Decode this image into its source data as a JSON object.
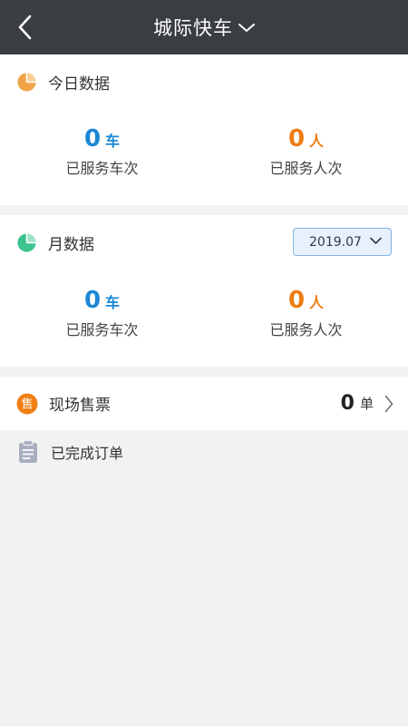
{
  "navbar": {
    "title": "城际快车",
    "back_icon": "back-chevron-icon",
    "dropdown_icon": "chevron-down-icon",
    "background": "#3a3d42"
  },
  "today": {
    "title": "今日数据",
    "icon": "pie-chart-icon",
    "icon_color": "#f0a44a",
    "stats": [
      {
        "value": "0",
        "unit": "车",
        "caption": "已服务车次",
        "color": "#1b87d6"
      },
      {
        "value": "0",
        "unit": "人",
        "caption": "已服务人次",
        "color": "#ed7d12"
      }
    ]
  },
  "month": {
    "title": "月数据",
    "icon": "pie-chart-icon",
    "icon_color": "#3cc48f",
    "selected_month": "2019.07",
    "stats": [
      {
        "value": "0",
        "unit": "车",
        "caption": "已服务车次",
        "color": "#1b87d6"
      },
      {
        "value": "0",
        "unit": "人",
        "caption": "已服务人次",
        "color": "#ed7d12"
      }
    ]
  },
  "ticket": {
    "title": "现场售票",
    "badge": "售",
    "count": "0",
    "unit": "单",
    "icon_color": "#f07f14"
  },
  "orders": {
    "title": "已完成订单",
    "icon": "clipboard-icon"
  }
}
